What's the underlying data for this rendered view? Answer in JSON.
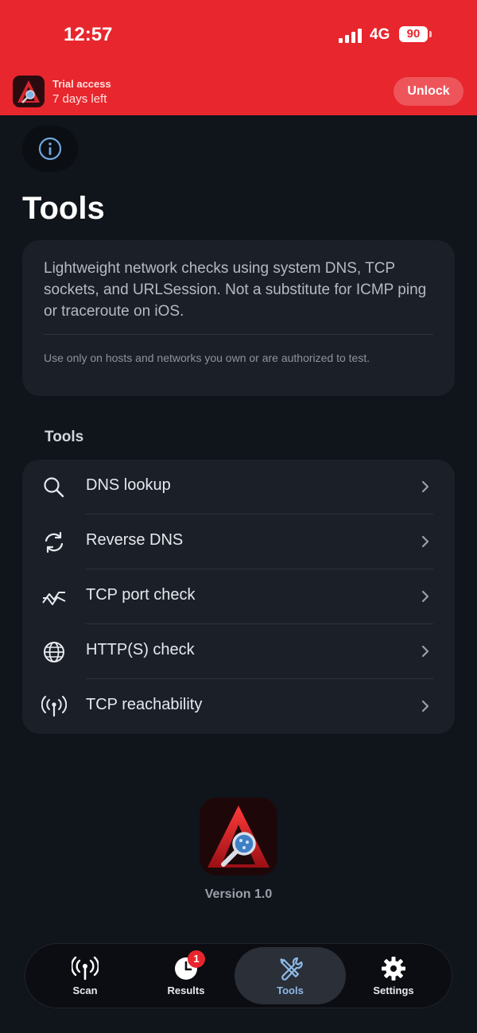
{
  "status": {
    "time": "12:57",
    "network": "4G",
    "battery": "90"
  },
  "trial": {
    "title": "Trial access",
    "subtitle": "7 days left",
    "unlock_label": "Unlock"
  },
  "page": {
    "title": "Tools",
    "description": "Lightweight network checks using system DNS, TCP sockets, and URLSession. Not a substitute for ICMP ping or traceroute on iOS.",
    "note": "Use only on hosts and networks you own or are authorized to test."
  },
  "tools": {
    "section_label": "Tools",
    "items": [
      {
        "label": "DNS lookup",
        "icon": "magnifier-icon"
      },
      {
        "label": "Reverse DNS",
        "icon": "refresh-icon"
      },
      {
        "label": "TCP port check",
        "icon": "waveform-icon"
      },
      {
        "label": "HTTP(S) check",
        "icon": "globe-icon"
      },
      {
        "label": "TCP reachability",
        "icon": "antenna-icon"
      }
    ]
  },
  "footer": {
    "version": "Version 1.0"
  },
  "tabbar": {
    "tabs": [
      {
        "label": "Scan",
        "icon": "antenna-icon"
      },
      {
        "label": "Results",
        "icon": "clock-icon",
        "badge": "1"
      },
      {
        "label": "Tools",
        "icon": "wrench-screwdriver-icon",
        "active": true
      },
      {
        "label": "Settings",
        "icon": "gear-icon"
      }
    ]
  },
  "colors": {
    "accent": "#e8262d",
    "background": "#10141b",
    "card": "#1b1f28",
    "active_tab": "#8fb9e6"
  }
}
